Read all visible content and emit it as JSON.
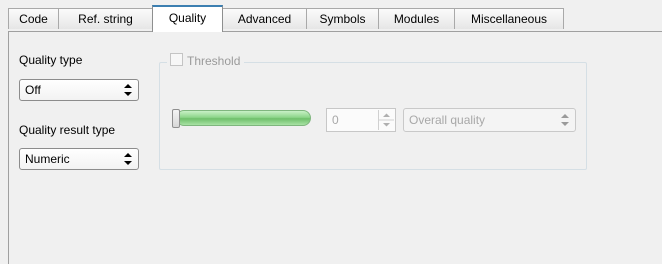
{
  "tabs": [
    {
      "label": "Code",
      "active": false
    },
    {
      "label": "Ref. string",
      "active": false
    },
    {
      "label": "Quality",
      "active": true
    },
    {
      "label": "Advanced",
      "active": false
    },
    {
      "label": "Symbols",
      "active": false
    },
    {
      "label": "Modules",
      "active": false
    },
    {
      "label": "Miscellaneous",
      "active": false
    }
  ],
  "quality_type": {
    "label": "Quality type",
    "value": "Off"
  },
  "quality_result_type": {
    "label": "Quality result type",
    "value": "Numeric"
  },
  "threshold": {
    "title": "Threshold",
    "checked": false,
    "enabled": false,
    "slider_level": 0,
    "spin_value": "0",
    "mode_value": "Overall quality"
  },
  "colors": {
    "active_tab_accent": "#3c7fb1",
    "slider_fill": "#8ed68b",
    "disabled_text": "#a8a8a8"
  }
}
